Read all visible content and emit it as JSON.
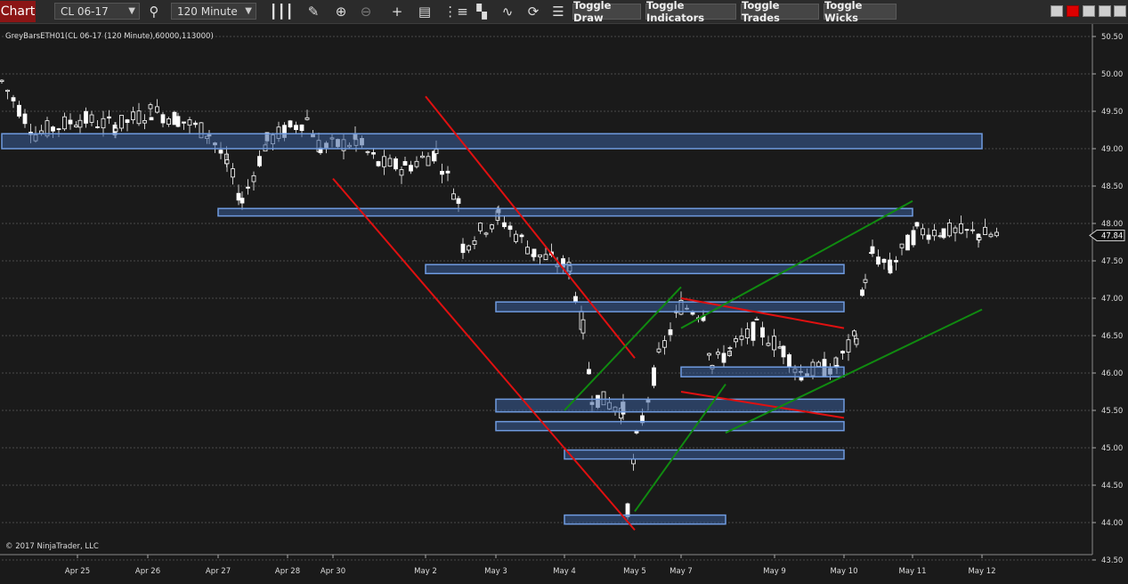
{
  "toolbar": {
    "chart_label": "Chart",
    "instrument": "CL 06-17",
    "interval": "120 Minute",
    "toggle_draw": "Toggle Draw",
    "toggle_indicators": "Toggle Indicators",
    "toggle_trades": "Toggle Trades",
    "toggle_wicks": "Toggle Wicks",
    "icons": [
      "search-icon",
      "bar-type-icon",
      "pencil-icon",
      "zoom-in-icon",
      "zoom-out-icon",
      "crosshair-icon",
      "data-box-icon",
      "bars-icon",
      "properties-icon",
      "strategy-icon",
      "reload-icon",
      "list-icon"
    ]
  },
  "chart": {
    "indicator_label": "GreyBarsETH01(CL 06-17 (120 Minute),60000,113000)",
    "copyright": "© 2017 NinjaTrader, LLC",
    "current_price": "47.84",
    "price_labels": [
      "50.50",
      "50.00",
      "49.50",
      "49.00",
      "48.50",
      "48.00",
      "47.50",
      "47.00",
      "46.50",
      "46.00",
      "45.50",
      "45.00",
      "44.50",
      "44.00",
      "43.50"
    ],
    "date_labels": [
      "Apr 25",
      "Apr 26",
      "Apr 27",
      "Apr 28",
      "Apr 30",
      "May 2",
      "May 3",
      "May 4",
      "May 5",
      "May 7",
      "May 9",
      "May 10",
      "May 11",
      "May 12"
    ],
    "colors": {
      "background": "#1a1a1a",
      "grid": "#4a4a4a",
      "zone_fill": "#3a5f9a",
      "zone_stroke": "#6f9be0",
      "red_line": "#e01010",
      "green_line": "#108a10",
      "candle_up": "#ffffff",
      "candle_down": "#ffffff",
      "wick": "#cccccc"
    },
    "zones": [
      {
        "from": "Apr 24",
        "to": "May 12",
        "top": 49.2,
        "bottom": 49.0
      },
      {
        "from": "Apr 27",
        "to": "May 11",
        "top": 48.2,
        "bottom": 48.1
      },
      {
        "from": "May 2",
        "to": "May 10",
        "top": 47.45,
        "bottom": 47.33
      },
      {
        "from": "May 3",
        "to": "May 10",
        "top": 46.95,
        "bottom": 46.82
      },
      {
        "from": "May 7",
        "to": "May 10",
        "top": 46.08,
        "bottom": 45.95
      },
      {
        "from": "May 3",
        "to": "May 10",
        "top": 45.65,
        "bottom": 45.48
      },
      {
        "from": "May 3",
        "to": "May 10",
        "top": 45.35,
        "bottom": 45.23
      },
      {
        "from": "May 4",
        "to": "May 10",
        "top": 44.97,
        "bottom": 44.85
      },
      {
        "from": "May 4",
        "to": "May 8",
        "top": 44.1,
        "bottom": 43.98
      }
    ],
    "red_lines": [
      {
        "from": [
          "May 2",
          49.7
        ],
        "to": [
          "May 5",
          46.2
        ]
      },
      {
        "from": [
          "Apr 30",
          48.6
        ],
        "to": [
          "May 5",
          43.9
        ]
      },
      {
        "from": [
          "May 7",
          47.0
        ],
        "to": [
          "May 10",
          46.6
        ]
      },
      {
        "from": [
          "May 7",
          45.75
        ],
        "to": [
          "May 10",
          45.4
        ]
      }
    ],
    "green_lines": [
      {
        "from": [
          "May 4",
          45.5
        ],
        "to": [
          "May 7",
          47.15
        ]
      },
      {
        "from": [
          "May 5",
          44.15
        ],
        "to": [
          "May 8",
          45.85
        ]
      },
      {
        "from": [
          "May 7",
          46.6
        ],
        "to": [
          "May 11",
          48.3
        ]
      },
      {
        "from": [
          "May 8",
          45.2
        ],
        "to": [
          "May 12",
          46.85
        ]
      }
    ]
  }
}
